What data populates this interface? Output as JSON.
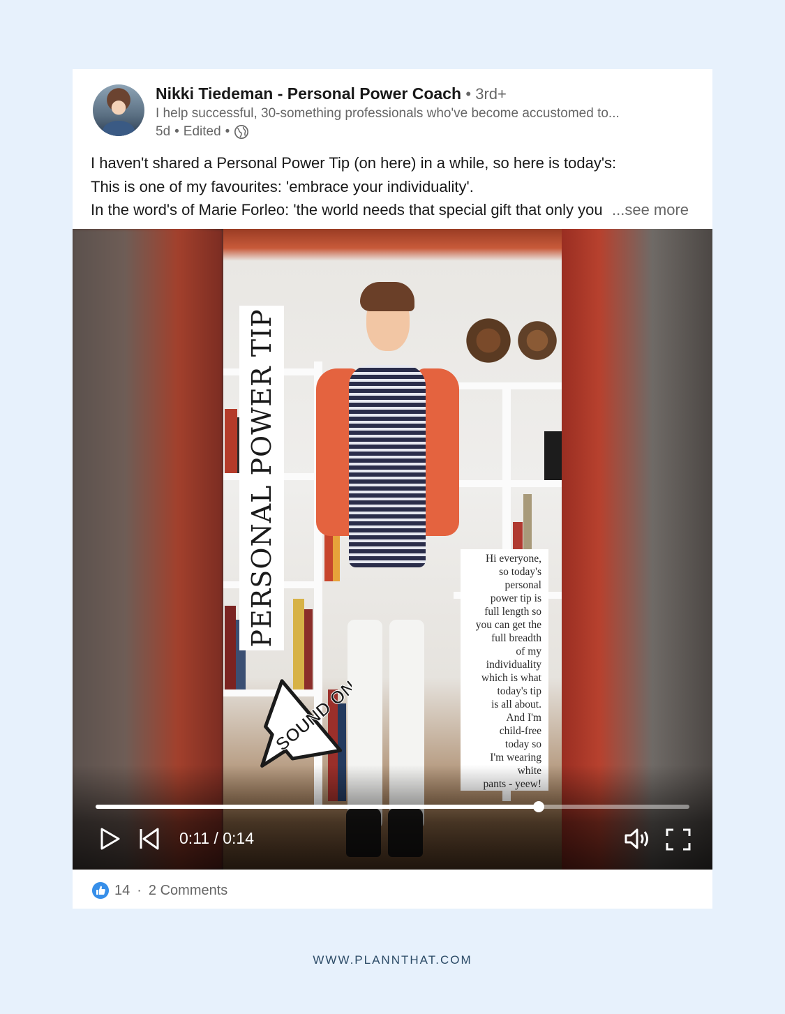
{
  "post": {
    "author_name": "Nikki Tiedeman - Personal Power Coach",
    "connection_degree": "3rd+",
    "headline": "I help successful, 30-something professionals who've become accustomed to...",
    "age": "5d",
    "edited_label": "Edited",
    "visibility_icon": "globe-icon",
    "text_line1": "I haven't shared a Personal Power Tip (on here) in a while, so here is today's:",
    "text_line2": "This is one of my favourites: 'embrace your individuality'.",
    "text_line3": "In the word's of Marie Forleo: 'the world needs that special gift that only you have'.",
    "see_more_label": "...see more"
  },
  "video": {
    "overlay_title": "PERSONAL POWER TIP",
    "sound_sticker": "SOUND ON",
    "caption": "Hi everyone,\nso today's\npersonal\npower tip is\nfull length so\nyou can get the\nfull breadth\nof my\nindividuality\nwhich is what\ntoday's tip\nis all about.\nAnd I'm\nchild-free\ntoday so\nI'm wearing\nwhite\npants - yeew!",
    "time_display": "0:11 / 0:14",
    "progress_fraction": 0.746,
    "controls": {
      "play_icon": "play-icon",
      "restart_icon": "skip-back-icon",
      "volume_icon": "volume-icon",
      "fullscreen_icon": "fullscreen-icon"
    }
  },
  "social": {
    "reaction_icon": "like-icon",
    "reaction_count": "14",
    "separator": "·",
    "comments_label": "2 Comments"
  },
  "footer": {
    "url": "WWW.PLANNTHAT.COM"
  },
  "colors": {
    "page_bg": "#e7f1fc",
    "like_blue": "#378fe9",
    "cardigan": "#e4633f"
  }
}
